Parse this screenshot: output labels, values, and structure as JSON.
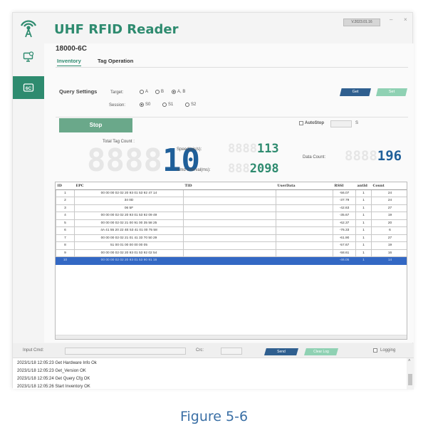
{
  "app": {
    "title": "UHF RFID Reader",
    "version": "V.2023.01.16",
    "window_controls": {
      "minimize": "–",
      "close": "×"
    }
  },
  "sidebar": {
    "items": [
      {
        "icon": "antenna-icon"
      },
      {
        "icon": "monitor-settings-icon"
      },
      {
        "icon": "6c-tag-icon",
        "label": "6C"
      }
    ]
  },
  "main": {
    "subtitle": "18000-6C",
    "tabs": [
      {
        "label": "Inventory",
        "active": true
      },
      {
        "label": "Tag Operation",
        "active": false
      }
    ]
  },
  "query_settings": {
    "heading": "Query Settings",
    "target_label": "Target:",
    "target_options": [
      {
        "label": "A",
        "selected": false
      },
      {
        "label": "B",
        "selected": false
      },
      {
        "label": "A, B",
        "selected": true
      }
    ],
    "session_label": "Session:",
    "session_options": [
      {
        "label": "S0",
        "selected": true
      },
      {
        "label": "S1",
        "selected": false
      },
      {
        "label": "S2",
        "selected": false
      }
    ],
    "get_label": "Get",
    "set_label": "Set"
  },
  "controls": {
    "stop_label": "Stop",
    "autostop_label": "AutoStop",
    "autostop_checked": false,
    "autostop_unit": "S"
  },
  "stats": {
    "total_tag_count_label": "Total Tag Count :",
    "total_tag_count_value": "10",
    "speed_label": "Speed(pic/s):",
    "speed_value": "113",
    "cmd_interval_label": "Cmd Interval(ms):",
    "cmd_interval_value": "2098",
    "data_count_label": "Data Count:",
    "data_count_value": "196"
  },
  "table": {
    "columns": [
      "ID",
      "EPC",
      "TID",
      "UserData",
      "RSSI",
      "antId",
      "Count"
    ],
    "rows": [
      [
        "1",
        "00 00 00 02 02 20 93 01 53 92 47 14",
        "",
        "",
        "-56.07",
        "1",
        "24"
      ],
      [
        "2",
        "34 0D",
        "",
        "",
        "-37.79",
        "1",
        "24"
      ],
      [
        "3",
        "06 5F",
        "",
        "",
        "-42.63",
        "1",
        "27"
      ],
      [
        "4",
        "00 00 00 02 02 20 93 01 53 92 09 49",
        "",
        "",
        "-35.67",
        "1",
        "19"
      ],
      [
        "5",
        "00 00 00 02 02 21 00 91 00 35 58 25",
        "",
        "",
        "-62.37",
        "1",
        "20"
      ],
      [
        "6",
        "4A 41 55 20 22 4E 53 41 01 00 75 58",
        "",
        "",
        "-76.33",
        "1",
        "6"
      ],
      [
        "7",
        "00 00 00 02 02 21 01 41 33 70 50 29",
        "",
        "",
        "-61.90",
        "1",
        "27"
      ],
      [
        "8",
        "51 00 01 00 00 00 00 05",
        "",
        "",
        "-57.67",
        "1",
        "19"
      ],
      [
        "9",
        "00 00 00 02 02 20 93 01 53 92 02 54",
        "",
        "",
        "-58.61",
        "1",
        "16"
      ],
      [
        "10",
        "00 00 00 02 02 20 93 01 53 90 91 16",
        "",
        "",
        "-46.05",
        "1",
        "14"
      ]
    ],
    "selected_row": 9
  },
  "command": {
    "input_label": "Input Cmd:",
    "input_value": "",
    "crc_label": "Crc:",
    "crc_value": "",
    "send_label": "Send",
    "clear_log_label": "Clear Log",
    "logging_label": "Logging",
    "logging_checked": false
  },
  "log": [
    "2023/1/18 12:05:23 Get Hardware Info Ok",
    "2023/1/18 12:05:23 Get_Version OK",
    "2023/1/18 12:05:24 Get Query Cfg OK",
    "2023/1/18 12:05:26 Start Inventory OK"
  ],
  "caption": "Figure 5-6",
  "colors": {
    "brand": "#2e8b6f",
    "button_primary": "#2f5f8f",
    "button_secondary": "#8fd1b3",
    "selection": "#3368c4",
    "digit_lit": "#1f5f99",
    "digit_dim": "#e6e6e6"
  }
}
